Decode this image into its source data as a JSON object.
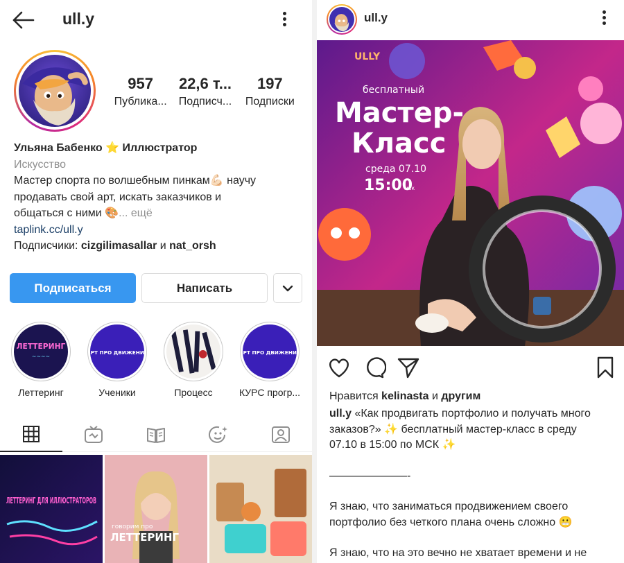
{
  "profile": {
    "handle": "ull.y",
    "stats": [
      {
        "value": "957",
        "label": "Публика..."
      },
      {
        "value": "22,6 т...",
        "label": "Подписч..."
      },
      {
        "value": "197",
        "label": "Подписки"
      }
    ],
    "name": "Ульяна Бабенко ⭐ Иллюстратор",
    "category": "Искусство",
    "bio_line1": "Мастер спорта по волшебным пинкам💪🏻 научу",
    "bio_line2": "продавать свой арт, искать заказчиков и",
    "bio_line3": "общаться с ними 🎨",
    "bio_more": "... ещё",
    "link": "taplink.cc/ull.y",
    "followers_prefix": "Подписчики: ",
    "follower1": "cizgilimasallar",
    "followers_and": " и ",
    "follower2": "nat_orsh",
    "follow_button": "Подписаться",
    "message_button": "Написать",
    "highlights": [
      {
        "label": "Леттеринг"
      },
      {
        "label": "Ученики"
      },
      {
        "label": "Процесс"
      },
      {
        "label": "КУРС прогр..."
      }
    ],
    "highlight_art": [
      "ЛЕТТЕРИНГ",
      "АРТ ПРО ДВИЖЕНИЕ",
      "",
      "АРТ ПРО ДВИЖЕНИЕ"
    ],
    "grid_text": {
      "cell2": "говорим про",
      "cell2b": "ЛЕТТЕРИНГ",
      "cell1": "ЛЕТТЕРИНГ ДЛЯ ИЛЛЮСТРАТОРОВ"
    }
  },
  "post": {
    "user": "ull.y",
    "image_text": {
      "brand": "ULLY",
      "free": "бесплатный",
      "title1": "Мастер-",
      "title2": "Класс",
      "date": "среда 07.10",
      "time": "15:00",
      "tz": "мск"
    },
    "likes_prefix": "Нравится ",
    "likes_user": "kelinasta",
    "likes_and": " и ",
    "likes_others": "другим",
    "caption_user": "ull.y",
    "caption_l1": " «Как продвигать портфолио и получать много",
    "caption_l2": "заказов?» ✨ бесплатный мастер-класс в среду",
    "caption_l3": "07.10 в 15:00 по МСК ✨",
    "caption_l4": "———————-",
    "caption_l5": "Я знаю, что заниматься продвижением своего",
    "caption_l6": "портфолио без четкого плана очень сложно 😬",
    "caption_l7": "Я знаю, что на это вечно не хватает времени и не"
  },
  "colors": {
    "accent": "#3897f0",
    "text": "#262626",
    "muted": "#8e8e8e",
    "link": "#1a3e66"
  }
}
